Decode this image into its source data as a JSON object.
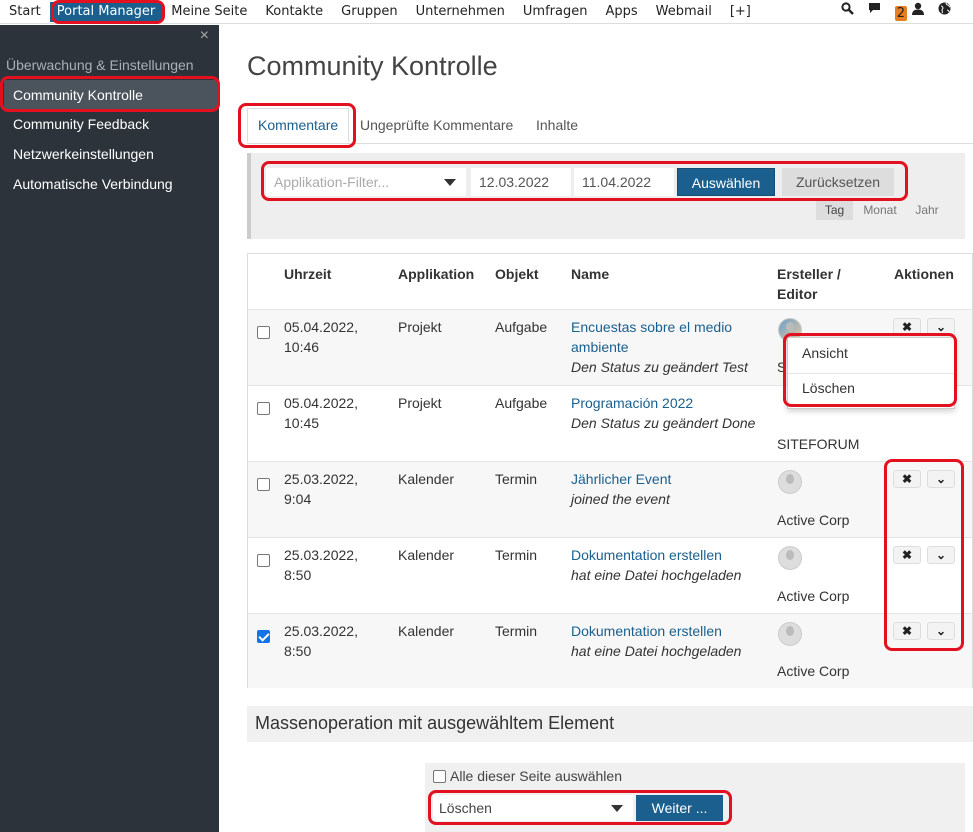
{
  "topnav": {
    "items": [
      "Start",
      "Portal Manager",
      "Meine Seite",
      "Kontakte",
      "Gruppen",
      "Unternehmen",
      "Umfragen",
      "Apps",
      "Webmail",
      "[+]"
    ],
    "notification_count": "2"
  },
  "sidebar": {
    "close": "×",
    "section_title": "Überwachung & Einstellungen",
    "items": [
      "Community Kontrolle",
      "Community Feedback",
      "Netzwerkeinstellungen",
      "Automatische Verbindung"
    ]
  },
  "main": {
    "title": "Community Kontrolle",
    "tabs": [
      "Kommentare",
      "Ungeprüfte Kommentare",
      "Inhalte"
    ],
    "filter": {
      "app_placeholder": "Applikation-Filter...",
      "date_from": "12.03.2022",
      "date_to": "11.04.2022",
      "select_button": "Auswählen",
      "reset_button": "Zurücksetzen",
      "periods": [
        "Tag",
        "Monat",
        "Jahr"
      ],
      "active_period": "Tag"
    },
    "table": {
      "headers": [
        "Uhrzeit",
        "Applikation",
        "Objekt",
        "Name",
        "Ersteller /",
        "Editor",
        "Aktionen"
      ],
      "rows": [
        {
          "time1": "05.04.2022,",
          "time2": "10:46",
          "app": "Projekt",
          "object": "Aufgabe",
          "name1": "Encuestas sobre el medio",
          "name2": "ambiente",
          "desc": "Den Status zu geändert Test",
          "creator": "S",
          "checked": false
        },
        {
          "time1": "05.04.2022,",
          "time2": "10:45",
          "app": "Projekt",
          "object": "Aufgabe",
          "name1": "Programación 2022",
          "name2": "",
          "desc": "Den Status zu geändert Done",
          "creator": "SITEFORUM",
          "checked": false
        },
        {
          "time1": "25.03.2022,",
          "time2": "9:04",
          "app": "Kalender",
          "object": "Termin",
          "name1": "Jährlicher Event",
          "name2": "",
          "desc": "joined the event",
          "creator": "Active Corp",
          "checked": false
        },
        {
          "time1": "25.03.2022,",
          "time2": "8:50",
          "app": "Kalender",
          "object": "Termin",
          "name1": "Dokumentation erstellen",
          "name2": "",
          "desc": "hat eine Datei hochgeladen",
          "creator": "Active Corp",
          "checked": false
        },
        {
          "time1": "25.03.2022,",
          "time2": "8:50",
          "app": "Kalender",
          "object": "Termin",
          "name1": "Dokumentation erstellen",
          "name2": "",
          "desc": "hat eine Datei hochgeladen",
          "creator": "Active Corp",
          "checked": true
        }
      ],
      "action_delete": "✖",
      "action_more": "⌄",
      "dropdown": [
        "Ansicht",
        "Löschen"
      ]
    },
    "mass": {
      "title": "Massenoperation mit ausgewähltem Element",
      "select_all": "Alle dieser Seite auswählen",
      "operation": "Löschen",
      "continue_button": "Weiter ..."
    }
  },
  "colors": {
    "primary": "#1a5f8e",
    "sidebar": "#2c333b",
    "highlight": "#e3101f",
    "badge": "#e67e22"
  }
}
